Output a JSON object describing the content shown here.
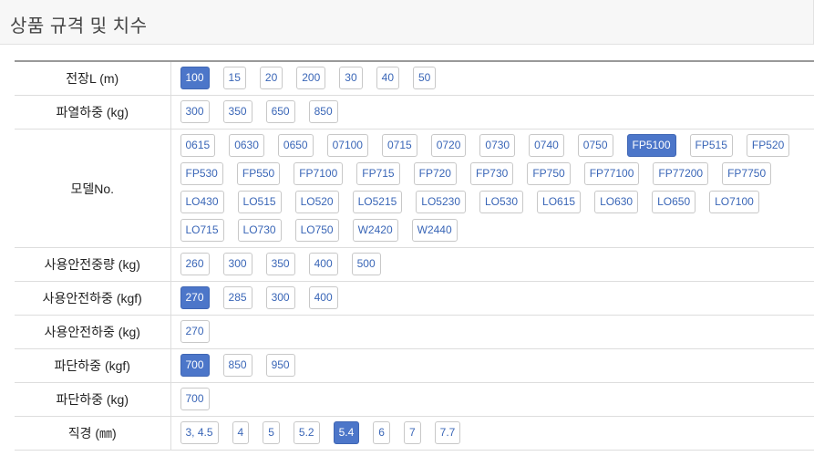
{
  "header": {
    "title": "상품 규격 및 치수"
  },
  "rows": [
    {
      "label": "전장L (m)",
      "options": [
        "100",
        "15",
        "20",
        "200",
        "30",
        "40",
        "50"
      ],
      "selected": [
        "100"
      ]
    },
    {
      "label": "파열하중 (kg)",
      "options": [
        "300",
        "350",
        "650",
        "850"
      ],
      "selected": []
    },
    {
      "label": "모델No.",
      "options": [
        "0615",
        "0630",
        "0650",
        "07100",
        "0715",
        "0720",
        "0730",
        "0740",
        "0750",
        "FP5100",
        "FP515",
        "FP520",
        "FP530",
        "FP550",
        "FP7100",
        "FP715",
        "FP720",
        "FP730",
        "FP750",
        "FP77100",
        "FP77200",
        "FP7750",
        "LO430",
        "LO515",
        "LO520",
        "LO5215",
        "LO5230",
        "LO530",
        "LO615",
        "LO630",
        "LO650",
        "LO7100",
        "LO715",
        "LO730",
        "LO750",
        "W2420",
        "W2440"
      ],
      "selected": [
        "FP5100"
      ]
    },
    {
      "label": "사용안전중량 (kg)",
      "options": [
        "260",
        "300",
        "350",
        "400",
        "500"
      ],
      "selected": []
    },
    {
      "label": "사용안전하중 (kgf)",
      "options": [
        "270",
        "285",
        "300",
        "400"
      ],
      "selected": [
        "270"
      ]
    },
    {
      "label": "사용안전하중 (kg)",
      "options": [
        "270"
      ],
      "selected": []
    },
    {
      "label": "파단하중 (kgf)",
      "options": [
        "700",
        "850",
        "950"
      ],
      "selected": [
        "700"
      ]
    },
    {
      "label": "파단하중 (kg)",
      "options": [
        "700"
      ],
      "selected": []
    },
    {
      "label": "직경 (㎜)",
      "options": [
        "3, 4.5",
        "4",
        "5",
        "5.2",
        "5.4",
        "6",
        "7",
        "7.7"
      ],
      "selected": [
        "5.4"
      ]
    }
  ]
}
